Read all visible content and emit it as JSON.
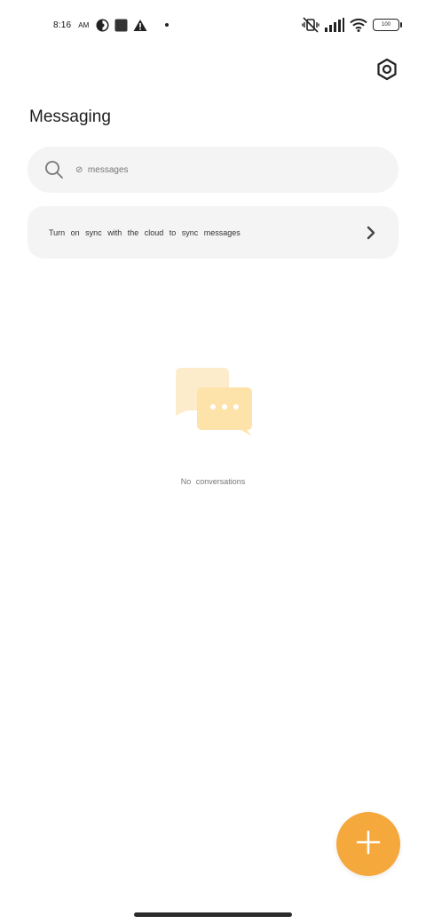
{
  "status_bar": {
    "time": "8:16",
    "ampm": "AM",
    "battery": "100"
  },
  "header": {
    "title": "Messaging"
  },
  "search": {
    "placeholder": "⊘  messages"
  },
  "sync_banner": {
    "text": "Turn on sync with the cloud to sync messages"
  },
  "empty_state": {
    "text": "No conversations"
  },
  "colors": {
    "accent": "#f5a83b",
    "card_background": "#f4f4f4",
    "illustration_light": "#fde9c4",
    "illustration_dark": "#fce0a6"
  },
  "icons": {
    "settings": "hexagon-settings-icon",
    "search": "search-icon",
    "chevron": "chevron-right-icon",
    "fab": "plus-icon"
  }
}
